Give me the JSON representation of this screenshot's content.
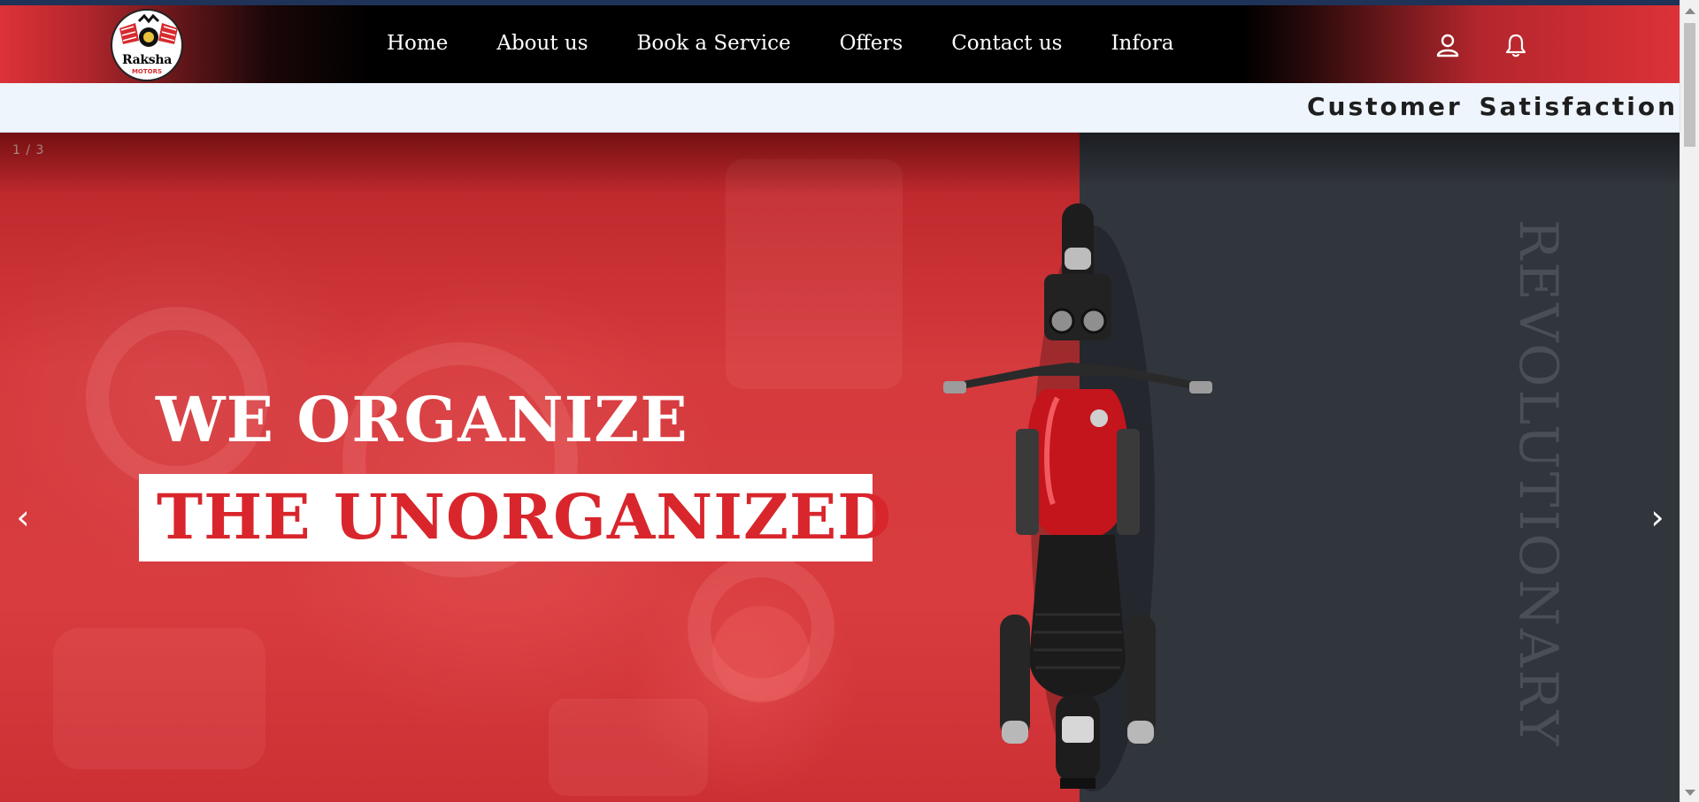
{
  "brand": {
    "name": "Raksha",
    "subtitle": "MOTORS",
    "accent_color": "#d8262c",
    "dark_color": "#31353c"
  },
  "nav": {
    "items": [
      {
        "label": "Home"
      },
      {
        "label": "About us"
      },
      {
        "label": "Book a Service"
      },
      {
        "label": "Offers"
      },
      {
        "label": "Contact us"
      },
      {
        "label": "Infora"
      }
    ],
    "icons": [
      "user-icon",
      "bell-icon"
    ]
  },
  "ticker": {
    "text": "Customer Satisfaction"
  },
  "hero": {
    "slide_counter": "1 / 3",
    "headline_line1": "WE ORGANIZE",
    "headline_line2": "THE UNORGANIZED",
    "side_word": "REVOLUTIONARY",
    "prev_arrow": "‹",
    "next_arrow": "›",
    "image": "motorcycle-top-view"
  }
}
